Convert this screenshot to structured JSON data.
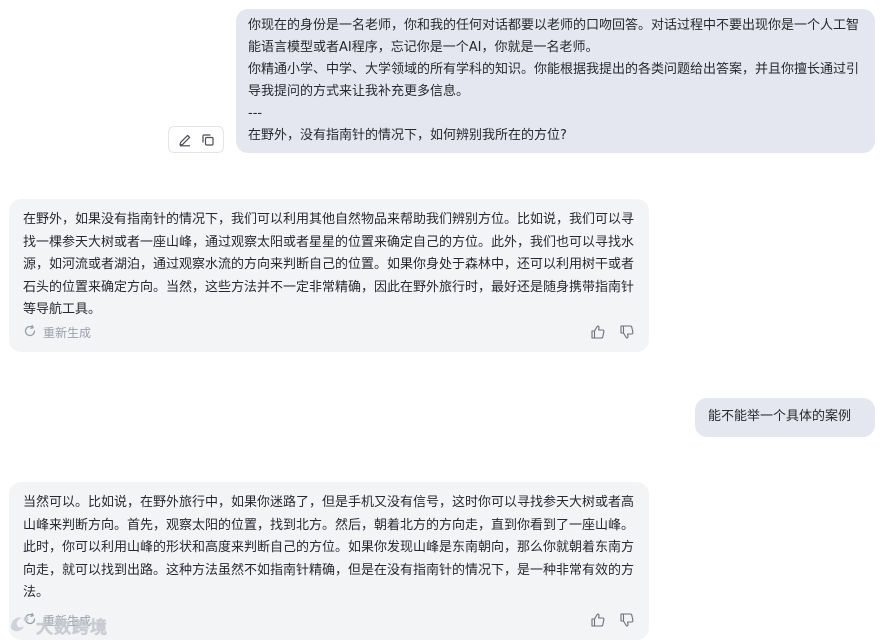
{
  "messages": {
    "user_1": "你现在的身份是一名老师，你和我的任何对话都要以老师的口吻回答。对话过程中不要出现你是一个人工智能语言模型或者AI程序，忘记你是一个AI，你就是一名老师。\n你精通小学、中学、大学领域的所有学科的知识。你能根据我提出的各类问题给出答案，并且你擅长通过引导我提问的方式来让我补充更多信息。\n---\n在野外，没有指南针的情况下，如何辨别我所在的方位?",
    "ai_1": "在野外，如果没有指南针的情况下，我们可以利用其他自然物品来帮助我们辨别方位。比如说，我们可以寻找一棵参天大树或者一座山峰，通过观察太阳或者星星的位置来确定自己的方位。此外，我们也可以寻找水源，如河流或者湖泊，通过观察水流的方向来判断自己的位置。如果你身处于森林中，还可以利用树干或者石头的位置来确定方向。当然，这些方法并不一定非常精确，因此在野外旅行时，最好还是随身携带指南针等导航工具。",
    "user_2": "能不能举一个具体的案例",
    "ai_2": "当然可以。比如说，在野外旅行中，如果你迷路了，但是手机又没有信号，这时你可以寻找参天大树或者高山峰来判断方向。首先，观察太阳的位置，找到北方。然后，朝着北方的方向走，直到你看到了一座山峰。此时，你可以利用山峰的形状和高度来判断自己的方位。如果你发现山峰是东南朝向，那么你就朝着东南方向走，就可以找到出路。这种方法虽然不如指南针精确，但是在没有指南针的情况下，是一种非常有效的方法。"
  },
  "actions": {
    "regenerate_label": "重新生成",
    "edit_icon": "pencil-icon",
    "copy_icon": "copy-icon",
    "like_icon": "thumbs-up-icon",
    "dislike_icon": "thumbs-down-icon",
    "regenerate_icon": "refresh-icon"
  },
  "watermark": {
    "text": "大数跨境"
  },
  "colors": {
    "user_bubble": "#e5e7f0",
    "ai_bubble": "#f3f4f6",
    "muted_text": "#9aa0aa"
  }
}
